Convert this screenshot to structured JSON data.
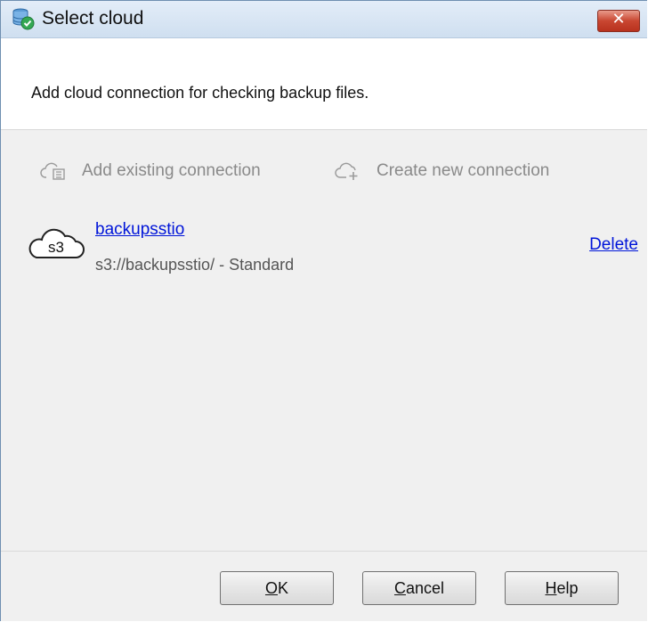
{
  "window": {
    "title": "Select cloud"
  },
  "header": {
    "description": "Add cloud connection for checking backup files."
  },
  "actions": {
    "add_existing": "Add existing connection",
    "create_new": "Create new connection"
  },
  "connections": [
    {
      "badge": "s3",
      "name": "backupsstio",
      "url": "s3://backupsstio/ - Standard",
      "delete_label": "Delete"
    }
  ],
  "buttons": {
    "ok": {
      "mnemonic": "O",
      "rest": "K"
    },
    "cancel": {
      "mnemonic": "C",
      "rest": "ancel"
    },
    "help": {
      "mnemonic": "H",
      "rest": "elp"
    }
  },
  "icons": {
    "app": "database-check-icon",
    "close": "close-icon",
    "add_existing": "cloud-list-icon",
    "create_new": "cloud-plus-icon",
    "connection": "cloud-s3-icon"
  },
  "colors": {
    "link": "#0015d9",
    "disabled_text": "#8a8a8a",
    "close_button": "#c94631"
  }
}
